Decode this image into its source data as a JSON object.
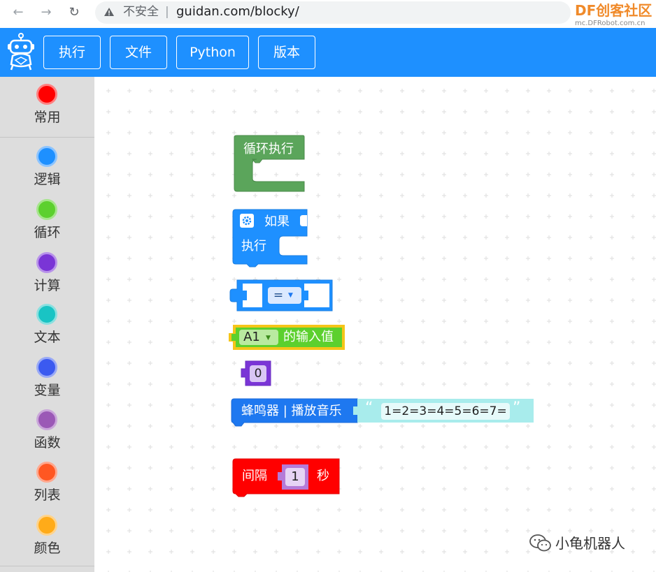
{
  "browser": {
    "security_label": "不安全",
    "separator": "|",
    "url": "guidan.com/blocky/",
    "site_logo_df": "DF",
    "site_logo_text": "创客社区",
    "site_logo_sub": "mc.DFRobot.com.cn"
  },
  "header": {
    "menu": [
      "执行",
      "文件",
      "Python",
      "版本"
    ]
  },
  "toolbox": {
    "categories": [
      {
        "label": "常用",
        "color": "#ff0000"
      },
      {
        "label": "逻辑",
        "color": "#1e90ff"
      },
      {
        "label": "循环",
        "color": "#5cd02e"
      },
      {
        "label": "计算",
        "color": "#7a35d6"
      },
      {
        "label": "文本",
        "color": "#19c4c4"
      },
      {
        "label": "变量",
        "color": "#3b5af0"
      },
      {
        "label": "函数",
        "color": "#9b59b6"
      },
      {
        "label": "列表",
        "color": "#ff5722"
      },
      {
        "label": "颜色",
        "color": "#ffab19"
      }
    ]
  },
  "blocks": {
    "loop": {
      "label": "循环执行",
      "color": "#5ba55b"
    },
    "if": {
      "if_label": "如果",
      "do_label": "执行",
      "color": "#1e90ff"
    },
    "compare": {
      "operator": "=",
      "color": "#1e90ff"
    },
    "input": {
      "pin": "A1",
      "label": "的输入值",
      "color": "#5cd02e",
      "highlight": "#f5c518"
    },
    "number": {
      "value": "0",
      "color": "#7a35d6"
    },
    "buzzer": {
      "label": "蜂鸣器 | 播放音乐",
      "open_quote": "“",
      "notes": "1=2=3=4=5=6=7=",
      "close_quote": "”",
      "color": "#1e78f0",
      "text_color": "#a8ecec"
    },
    "delay": {
      "label": "间隔",
      "value": "1",
      "unit": "秒",
      "color": "#ff0000"
    }
  },
  "watermark": {
    "text": "小龟机器人"
  }
}
